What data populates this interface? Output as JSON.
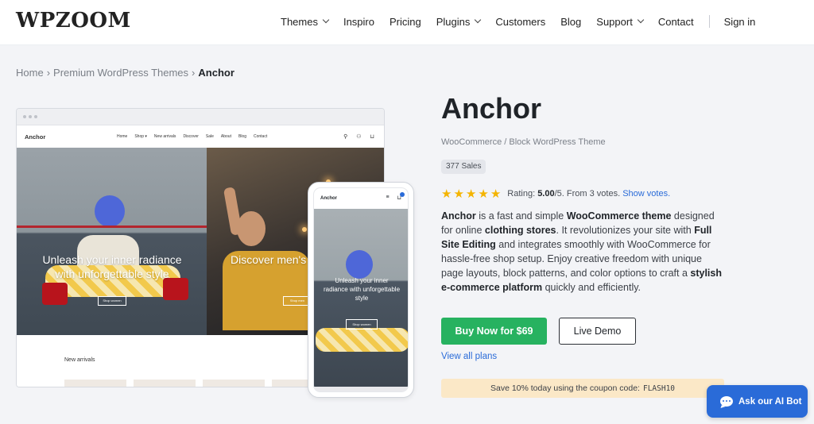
{
  "header": {
    "logo": "WPZOOM",
    "nav": [
      {
        "label": "Themes",
        "dropdown": true
      },
      {
        "label": "Inspiro",
        "dropdown": false
      },
      {
        "label": "Pricing",
        "dropdown": false
      },
      {
        "label": "Plugins",
        "dropdown": true
      },
      {
        "label": "Customers",
        "dropdown": false
      },
      {
        "label": "Blog",
        "dropdown": false
      },
      {
        "label": "Support",
        "dropdown": true
      },
      {
        "label": "Contact",
        "dropdown": false
      }
    ],
    "sign_in": "Sign in"
  },
  "breadcrumb": {
    "home": "Home",
    "section": "Premium WordPress Themes",
    "current": "Anchor",
    "separator": "›"
  },
  "preview": {
    "desktop": {
      "logo": "Anchor",
      "links": [
        "Home",
        "Shop ▾",
        "New arrivals",
        "Discover",
        "Sale",
        "About",
        "Blog",
        "Contact"
      ],
      "hero_left_title": "Unleash your inner radiance with unforgettable style",
      "hero_right_title": "Discover men's essentials at th",
      "hero_button": "Shop women",
      "hero_button_right": "Shop men",
      "section_label": "New arrivals"
    },
    "mobile": {
      "logo": "Anchor",
      "hero_title": "Unleash your inner radiance with unforgettable style",
      "hero_button": "Shop women"
    }
  },
  "product": {
    "title": "Anchor",
    "subtitle": "WooCommerce / Block WordPress Theme",
    "sales": "377 Sales",
    "rating": {
      "stars": 5,
      "label": "Rating:",
      "value": "5.00",
      "suffix": "/5. From 3 votes.",
      "link": "Show votes."
    },
    "description": {
      "p1_bold": "Anchor",
      "p1": " is a fast and simple ",
      "p2_bold": "WooCommerce theme",
      "p2": " designed for online ",
      "p3_bold": "clothing stores",
      "p3": ". It revolutionizes your site with ",
      "p4_bold": "Full Site Editing",
      "p4": " and integrates smoothly with WooCommerce for hassle-free shop setup. Enjoy creative freedom with unique page layouts, block patterns, and color options to craft a ",
      "p5_bold": "stylish e-commerce platform",
      "p5": " quickly and efficiently."
    },
    "buy_label": "Buy Now for $69",
    "demo_label": "Live Demo",
    "plans_link": "View all plans",
    "coupon_text": "Save 10% today using the coupon code:",
    "coupon_code": "FLASH10"
  },
  "chat": {
    "label": "Ask our AI Bot"
  },
  "colors": {
    "accent": "#2a6bd8",
    "buy_green": "#27b260",
    "star": "#f4b400",
    "coupon_bg": "#fbe8c7"
  }
}
